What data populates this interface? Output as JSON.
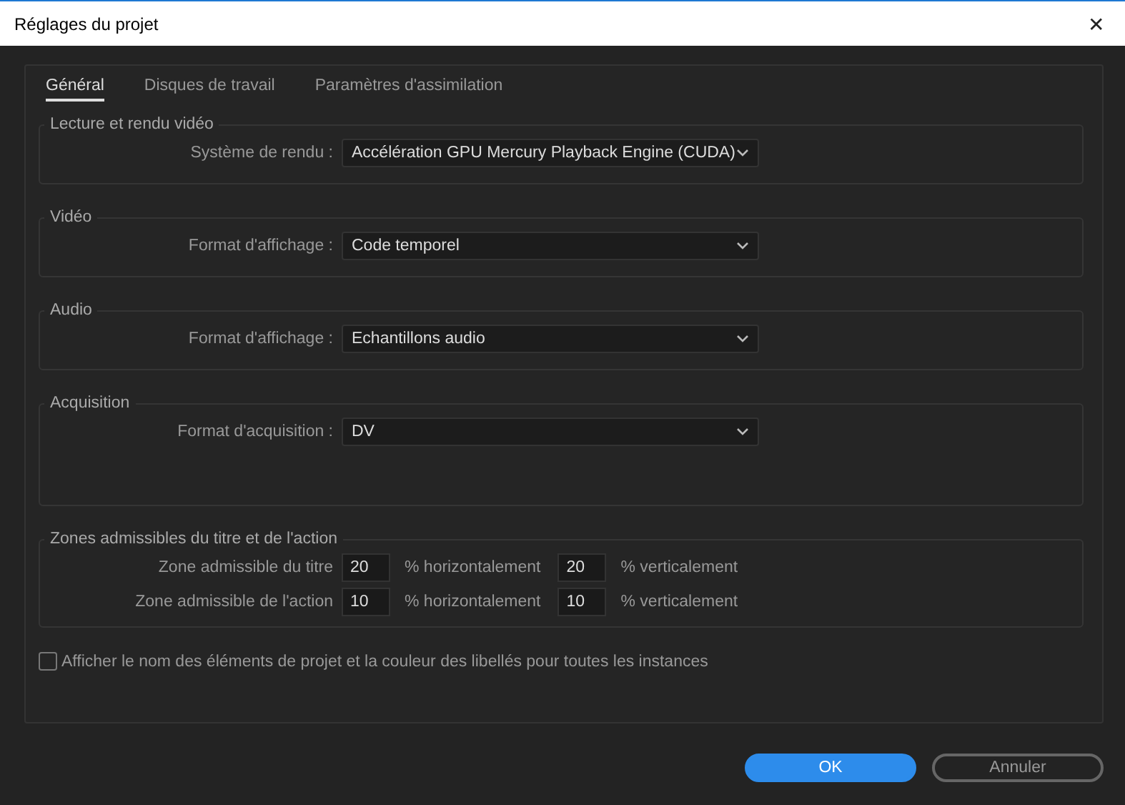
{
  "window": {
    "title": "Réglages du projet",
    "close": "✕"
  },
  "tabs": [
    {
      "label": "Général",
      "selected": true
    },
    {
      "label": "Disques de travail",
      "selected": false
    },
    {
      "label": "Paramètres d'assimilation",
      "selected": false
    }
  ],
  "groups": [
    {
      "title": "Lecture et rendu vidéo",
      "kind": "dropdown",
      "label": "Système de rendu :",
      "value": "Accélération GPU Mercury Playback Engine (CUDA)"
    },
    {
      "title": "Vidéo",
      "kind": "dropdown",
      "label": "Format d'affichage :",
      "value": "Code temporel"
    },
    {
      "title": "Audio",
      "kind": "dropdown",
      "label": "Format d'affichage :",
      "value": "Echantillons audio"
    },
    {
      "title": "Acquisition",
      "kind": "dropdown_tall",
      "label": "Format d'acquisition :",
      "value": "DV"
    },
    {
      "title": "Zones admissibles du titre et de l'action",
      "kind": "zones",
      "rows": [
        {
          "label": "Zone admissible du titre",
          "horizontal": "20",
          "horizontal_unit": "% horizontalement",
          "vertical": "20",
          "vertical_unit": "% verticalement"
        },
        {
          "label": "Zone admissible de l'action",
          "horizontal": "10",
          "horizontal_unit": "% horizontalement",
          "vertical": "10",
          "vertical_unit": "% verticalement"
        }
      ]
    }
  ],
  "checkbox": {
    "label": "Afficher le nom des éléments de projet et la couleur des libellés pour toutes les instances",
    "checked": false
  },
  "buttons": [
    {
      "label": "OK",
      "kind": "primary"
    },
    {
      "label": "Annuler",
      "kind": "secondary"
    }
  ]
}
